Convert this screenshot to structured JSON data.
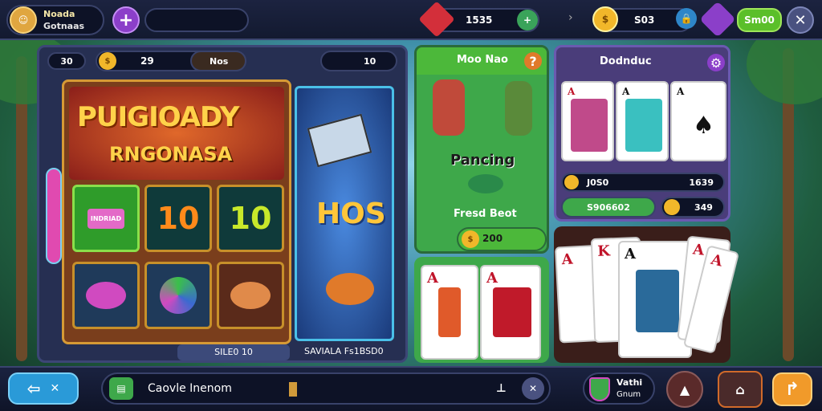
{
  "player": {
    "name": "Noada",
    "subtitle": "Gotnaas"
  },
  "currency": {
    "gems": "1535",
    "coins": "S03",
    "reward_button": "Sm00"
  },
  "slot_header": {
    "left_value": "30",
    "coins_value": "29",
    "label": "Nos",
    "right_value": "10"
  },
  "slot": {
    "title_line1": "PUIGIOADY",
    "title_line2": "RNGONASA",
    "cells": [
      "INDRIAD",
      "10",
      "10",
      "",
      "",
      ""
    ],
    "side_text": "HOS",
    "footer_left": "SILE0 10",
    "footer_right": "SAVIALA Fs1BSD0"
  },
  "fishing": {
    "header": "Moo Nao",
    "title": "Pancing",
    "subtitle": "Fresd Beot",
    "value": "200"
  },
  "cards_panel": {
    "header": "Dodnduc",
    "stat1": "J0S0",
    "stat2": "1639",
    "stat3": "S906602",
    "stat4": "349"
  },
  "mini_cards": [
    {
      "rank": "A"
    },
    {
      "rank": "A"
    }
  ],
  "hand_cards": [
    {
      "rank": "A"
    },
    {
      "rank": "K"
    },
    {
      "rank": "A"
    },
    {
      "rank": "A"
    },
    {
      "rank": "A"
    }
  ],
  "bottom": {
    "chat_label": "Caovle Inenom",
    "badge_line1": "Vathi",
    "badge_line2": "Gnum"
  },
  "colors": {
    "gold": "#f1b72a",
    "green": "#5bbf2a",
    "purple": "#7a3fb8",
    "red": "#c0142a"
  },
  "icons": [
    "back-arrow-icon",
    "close-icon",
    "plus-icon",
    "gem-icon",
    "coin-icon",
    "lock-icon",
    "shield-icon",
    "share-icon",
    "settings-icon"
  ]
}
